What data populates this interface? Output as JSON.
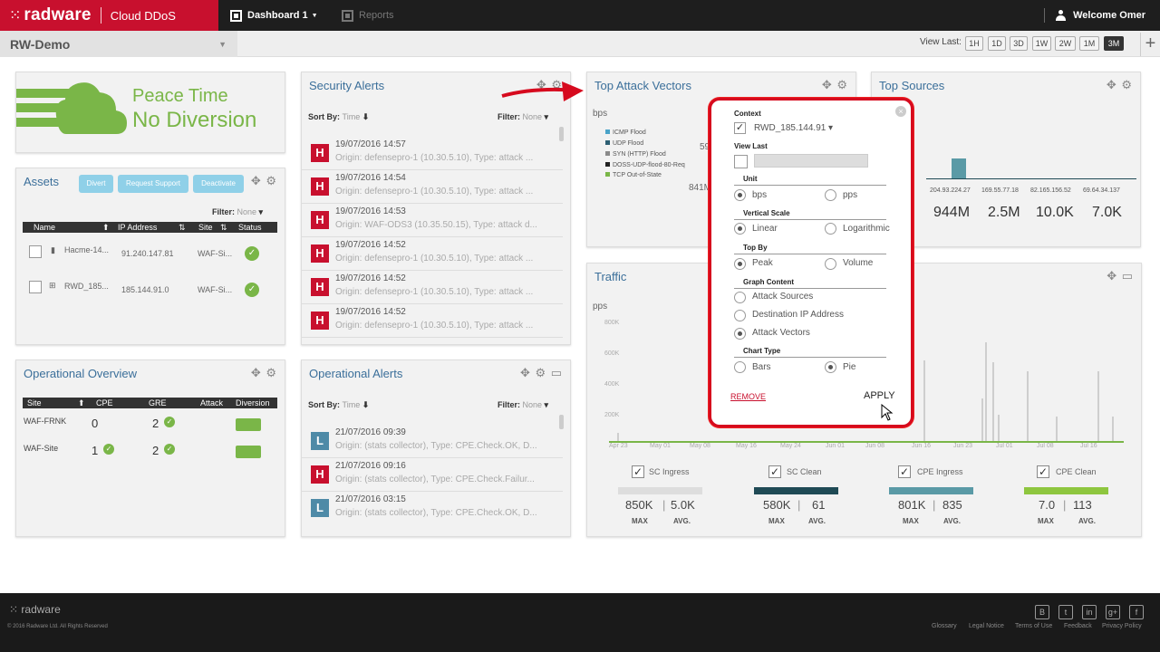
{
  "header": {
    "logo": "radware",
    "product": "Cloud DDoS",
    "dashboard_tab": "Dashboard 1",
    "reports_tab": "Reports",
    "welcome": "Welcome Omer"
  },
  "subbar": {
    "site": "RW-Demo",
    "view_last_label": "View Last:",
    "ranges": [
      "1H",
      "1D",
      "3D",
      "1W",
      "2W",
      "1M",
      "3M"
    ],
    "active_range": "3M"
  },
  "status": {
    "line1": "Peace Time",
    "line2": "No Diversion"
  },
  "assets": {
    "title": "Assets",
    "buttons": [
      "Divert",
      "Request Support",
      "Deactivate"
    ],
    "filter_label": "Filter:",
    "filter_value": "None",
    "columns": [
      "Name",
      "IP Address",
      "Site",
      "Status"
    ],
    "rows": [
      {
        "name": "Hacme-14...",
        "ip": "91.240.147.81",
        "site": "WAF-Si..."
      },
      {
        "name": "RWD_185...",
        "ip": "185.144.91.0",
        "site": "WAF-Si..."
      }
    ]
  },
  "security_alerts": {
    "title": "Security Alerts",
    "sort_label": "Sort By:",
    "sort_value": "Time",
    "filter_label": "Filter:",
    "filter_value": "None",
    "rows": [
      {
        "sev": "H",
        "date": "19/07/2016 14:57",
        "desc": "Origin: defensepro-1 (10.30.5.10), Type: attack ..."
      },
      {
        "sev": "H",
        "date": "19/07/2016 14:54",
        "desc": "Origin: defensepro-1 (10.30.5.10), Type: attack ..."
      },
      {
        "sev": "H",
        "date": "19/07/2016 14:53",
        "desc": "Origin: WAF-ODS3 (10.35.50.15), Type: attack d..."
      },
      {
        "sev": "H",
        "date": "19/07/2016 14:52",
        "desc": "Origin: defensepro-1 (10.30.5.10), Type: attack ..."
      },
      {
        "sev": "H",
        "date": "19/07/2016 14:52",
        "desc": "Origin: defensepro-1 (10.30.5.10), Type: attack ..."
      },
      {
        "sev": "H",
        "date": "19/07/2016 14:52",
        "desc": "Origin: defensepro-1 (10.30.5.10), Type: attack ..."
      }
    ]
  },
  "top_attack_vectors": {
    "title": "Top Attack Vectors",
    "unit": "bps",
    "legend": [
      {
        "name": "ICMP Flood",
        "color": "#4aa3c8"
      },
      {
        "name": "UDP Flood",
        "color": "#2d5f73"
      },
      {
        "name": "SYN (HTTP) Flood",
        "color": "#8a8a8a"
      },
      {
        "name": "DOSS-UDP-flood-80-Req",
        "color": "#222222"
      },
      {
        "name": "TCP Out-of-State",
        "color": "#7ab648"
      }
    ],
    "partial_values": [
      "59",
      "841M"
    ]
  },
  "top_sources": {
    "title": "Top Sources",
    "sources": [
      "204.93.224.27",
      "169.55.77.18",
      "82.165.156.52",
      "69.64.34.137"
    ],
    "values": [
      "944M",
      "2.5M",
      "10.0K",
      "7.0K"
    ]
  },
  "operational_overview": {
    "title": "Operational Overview",
    "columns": [
      "Site",
      "CPE",
      "GRE",
      "Attack",
      "Diversion"
    ],
    "rows": [
      {
        "site": "WAF-FRNK",
        "cpe": "0",
        "gre": "2"
      },
      {
        "site": "WAF-Site",
        "cpe": "1",
        "gre": "2"
      }
    ]
  },
  "operational_alerts": {
    "title": "Operational Alerts",
    "sort_label": "Sort By:",
    "sort_value": "Time",
    "filter_label": "Filter:",
    "filter_value": "None",
    "rows": [
      {
        "sev": "L",
        "date": "21/07/2016 09:39",
        "desc": "Origin: (stats collector), Type: CPE.Check.OK, D..."
      },
      {
        "sev": "H",
        "date": "21/07/2016 09:16",
        "desc": "Origin: (stats collector), Type: CPE.Check.Failur..."
      },
      {
        "sev": "L",
        "date": "21/07/2016 03:15",
        "desc": "Origin: (stats collector), Type: CPE.Check.OK, D..."
      }
    ]
  },
  "traffic": {
    "title": "Traffic",
    "unit": "pps",
    "y_ticks": [
      "800K",
      "600K",
      "400K",
      "200K"
    ],
    "x_ticks": [
      "Apr 23",
      "May 01",
      "May 08",
      "May 16",
      "May 24",
      "Jun 01",
      "Jun 08",
      "Jun 16",
      "Jun 23",
      "Jul 01",
      "Jul 08",
      "Jul 16"
    ],
    "series": [
      {
        "name": "SC Ingress",
        "color": "#dddddd",
        "max": "850K",
        "avg": "5.0K"
      },
      {
        "name": "SC Clean",
        "color": "#1f4a55",
        "max": "580K",
        "avg": "61"
      },
      {
        "name": "CPE Ingress",
        "color": "#5a9aa6",
        "max": "801K",
        "avg": "835"
      },
      {
        "name": "CPE Clean",
        "color": "#8ec63f",
        "max": "7.0",
        "avg": "113"
      }
    ],
    "max_label": "MAX",
    "avg_label": "AVG."
  },
  "popup": {
    "context_label": "Context",
    "context_value": "RWD_185.144.91",
    "view_last_label": "View Last",
    "unit_label": "Unit",
    "unit_options": [
      "bps",
      "pps"
    ],
    "scale_label": "Vertical Scale",
    "scale_options": [
      "Linear",
      "Logarithmic"
    ],
    "topby_label": "Top By",
    "topby_options": [
      "Peak",
      "Volume"
    ],
    "content_label": "Graph Content",
    "content_options": [
      "Attack Sources",
      "Destination IP Address",
      "Attack Vectors"
    ],
    "charttype_label": "Chart Type",
    "charttype_options": [
      "Bars",
      "Pie"
    ],
    "remove": "REMOVE",
    "apply": "APPLY"
  },
  "footer": {
    "logo": "radware",
    "copyright": "© 2016 Radware Ltd. All Rights Reserved",
    "links": [
      "Glossary",
      "Legal Notice",
      "Terms of Use",
      "Feedback",
      "Privacy Policy"
    ]
  }
}
